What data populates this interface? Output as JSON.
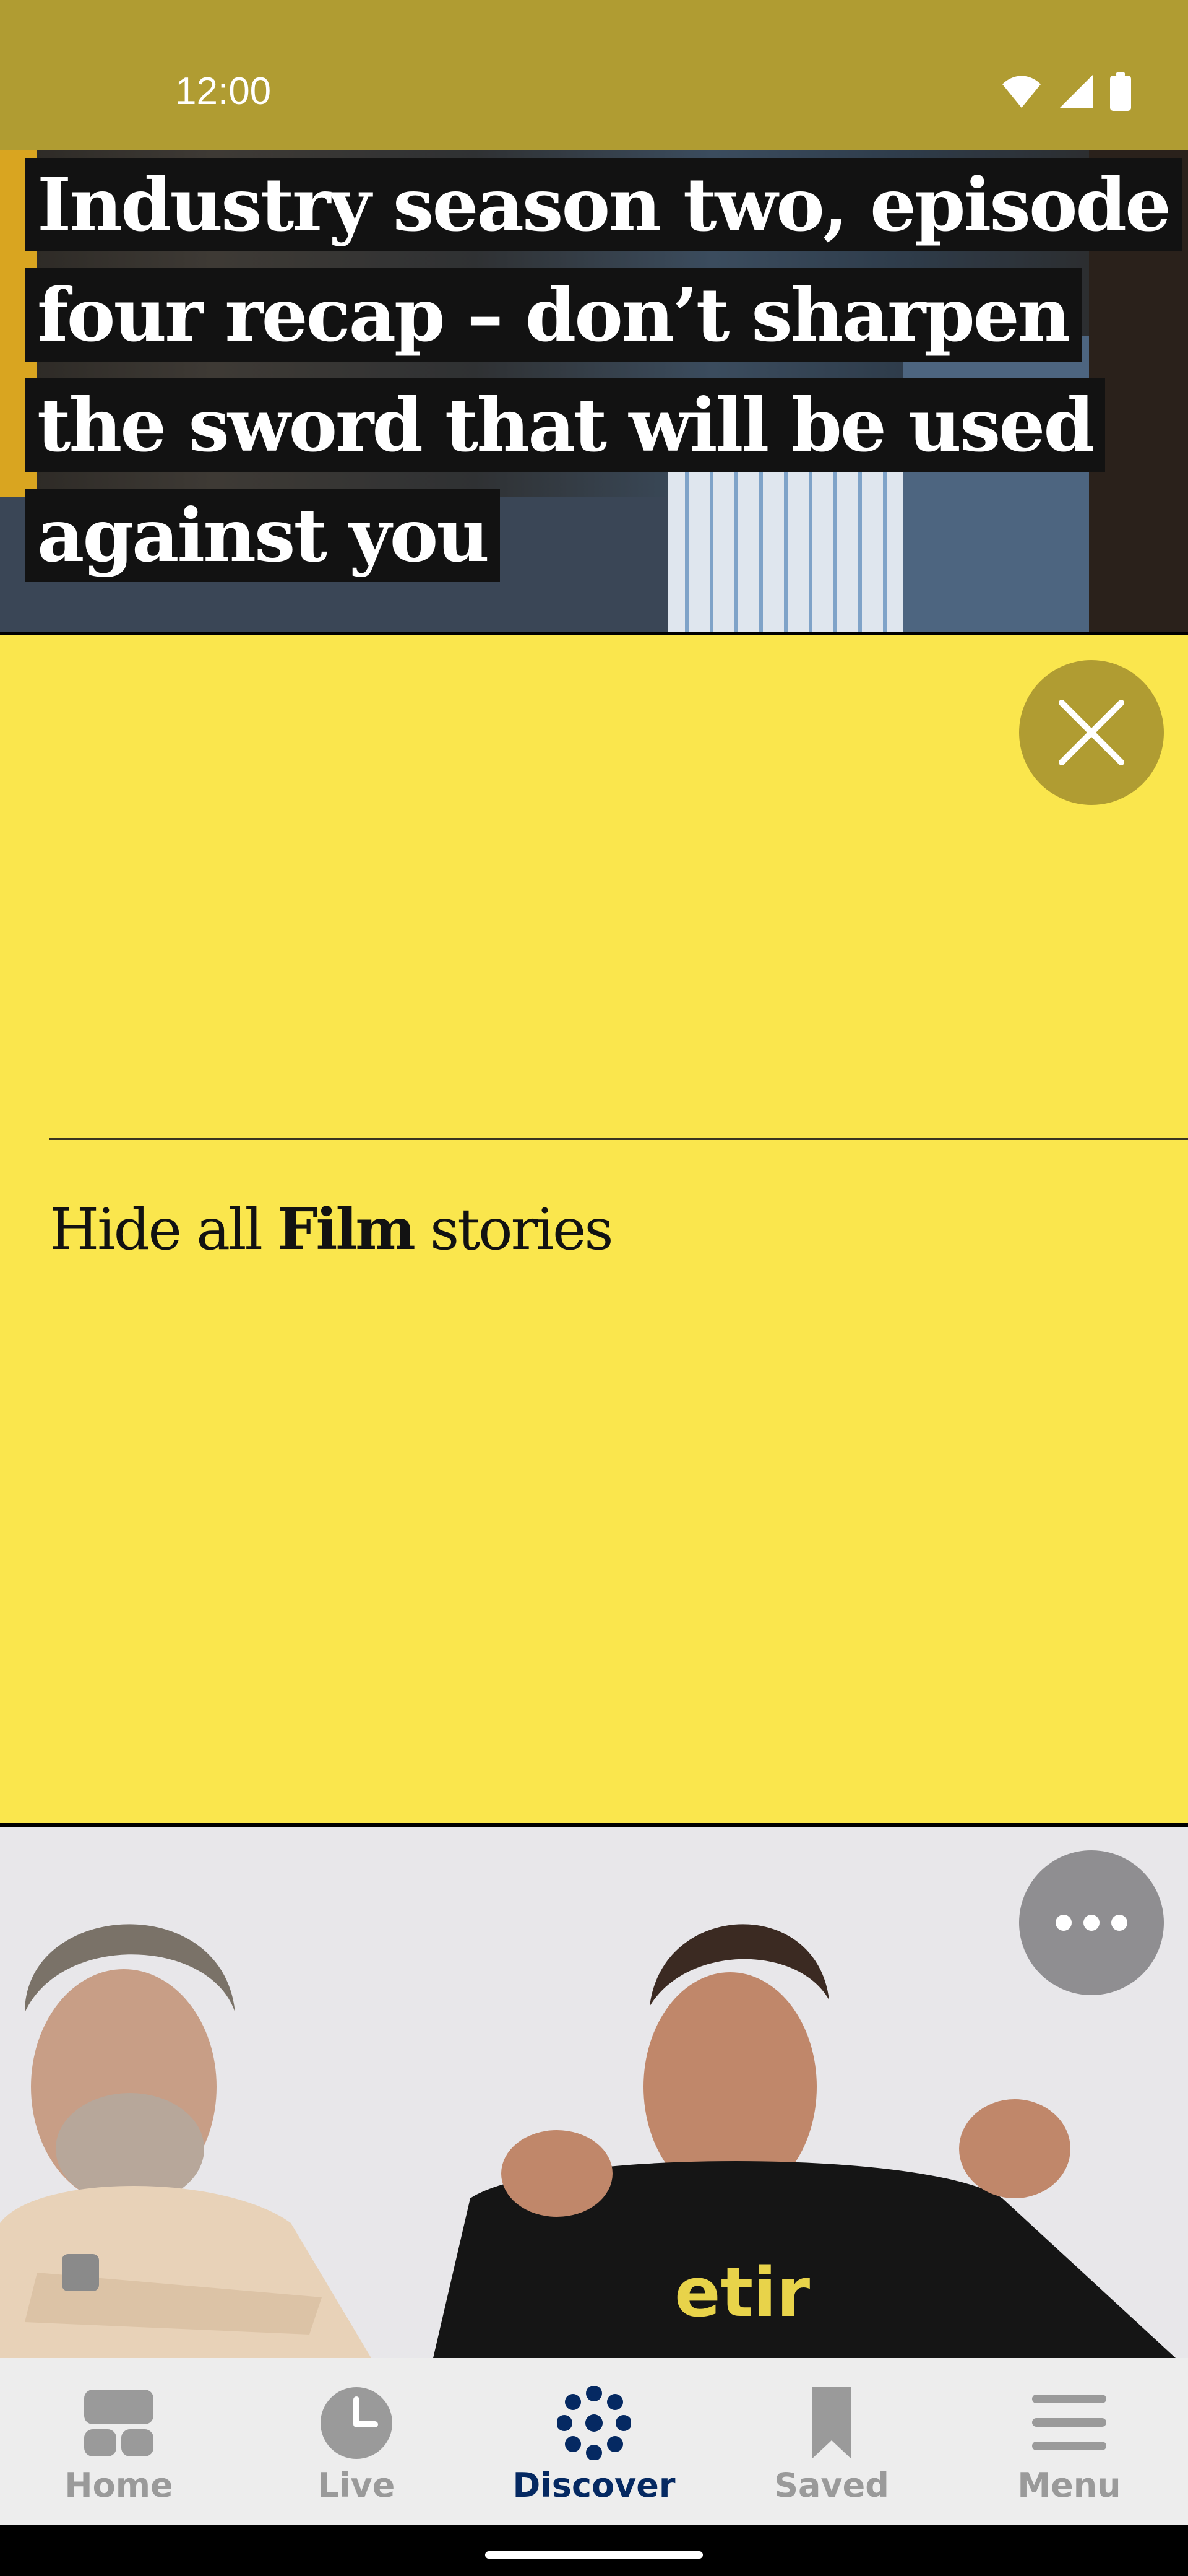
{
  "status_bar": {
    "time": "12:00",
    "icons": [
      "wifi-icon",
      "signal-icon",
      "battery-icon"
    ],
    "background": "#b09c32"
  },
  "top_article": {
    "headline": "Industry season two, episode four recap – don’t sharpen the sword that will be used against you"
  },
  "options_panel": {
    "background": "#fae64d",
    "close_icon": "close-icon",
    "hide_prefix": "Hide all ",
    "hide_topic": "Film",
    "hide_suffix": " stories"
  },
  "bottom_article": {
    "more_icon": "more-options-icon",
    "shirt_text": "etir"
  },
  "nav": {
    "items": [
      {
        "label": "Home",
        "icon": "home-icon",
        "active": false
      },
      {
        "label": "Live",
        "icon": "clock-icon",
        "active": false
      },
      {
        "label": "Discover",
        "icon": "discover-icon",
        "active": true
      },
      {
        "label": "Saved",
        "icon": "bookmark-icon",
        "active": false
      },
      {
        "label": "Menu",
        "icon": "menu-icon",
        "active": false
      }
    ],
    "active_color": "#052962",
    "inactive_color": "#9a9a9a"
  }
}
